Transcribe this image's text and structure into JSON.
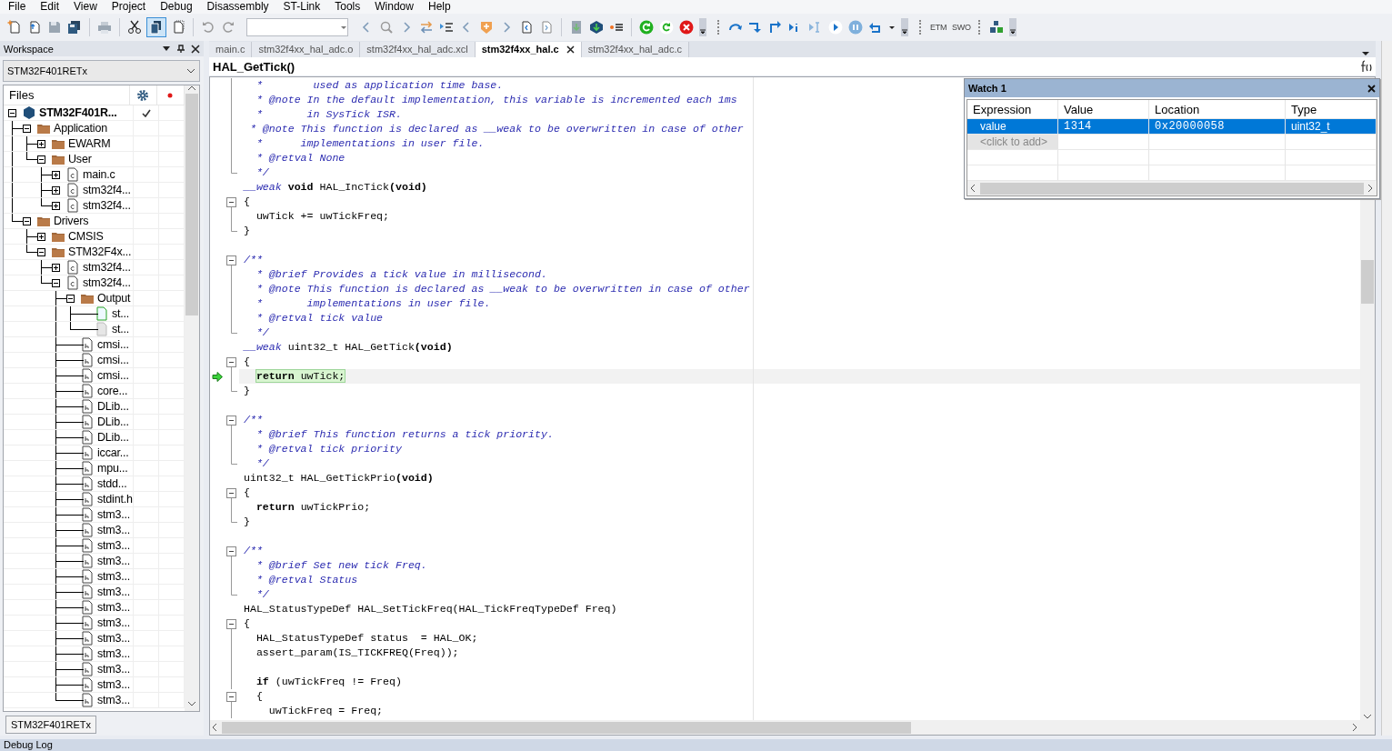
{
  "menu": [
    "File",
    "Edit",
    "View",
    "Project",
    "Debug",
    "Disassembly",
    "ST-Link",
    "Tools",
    "Window",
    "Help"
  ],
  "toolbar": {
    "labels": [
      "ETM",
      "SWO"
    ]
  },
  "workspace": {
    "title": "Workspace",
    "configuration": "STM32F401RETx",
    "files_header": "Files",
    "bottom_tab": "STM32F401RETx",
    "tree": [
      {
        "label": "STM32F401R...",
        "kind": "project",
        "expanded": true,
        "checked": true,
        "children": [
          {
            "label": "Application",
            "kind": "folder",
            "expanded": true,
            "checked": false,
            "children": [
              {
                "label": "EWARM",
                "kind": "folder",
                "expanded": false,
                "checked": false
              },
              {
                "label": "User",
                "kind": "folder",
                "expanded": true,
                "checked": false,
                "children": [
                  {
                    "label": "main.c",
                    "kind": "c_file",
                    "expanded": false,
                    "checked": false
                  },
                  {
                    "label": "stm32f4...",
                    "kind": "c_file",
                    "expanded": false,
                    "checked": false
                  },
                  {
                    "label": "stm32f4...",
                    "kind": "c_file",
                    "expanded": false,
                    "checked": false
                  }
                ]
              }
            ]
          },
          {
            "label": "Drivers",
            "kind": "folder",
            "expanded": true,
            "checked": false,
            "children": [
              {
                "label": "CMSIS",
                "kind": "folder",
                "expanded": false,
                "checked": false
              },
              {
                "label": "STM32F4x...",
                "kind": "folder",
                "expanded": true,
                "checked": false,
                "children": [
                  {
                    "label": "stm32f4...",
                    "kind": "c_file",
                    "expanded": false,
                    "checked": false
                  },
                  {
                    "label": "stm32f4...",
                    "kind": "c_file",
                    "expanded": true,
                    "checked": false,
                    "children": [
                      {
                        "label": "Output",
                        "kind": "folder",
                        "expanded": true,
                        "checked": false,
                        "children": [
                          {
                            "label": "st...",
                            "kind": "new_file",
                            "checked": false
                          },
                          {
                            "label": "st...",
                            "kind": "file",
                            "checked": false
                          }
                        ]
                      },
                      {
                        "label": "cmsi...",
                        "kind": "h_file",
                        "checked": false
                      },
                      {
                        "label": "cmsi...",
                        "kind": "h_file",
                        "checked": false
                      },
                      {
                        "label": "cmsi...",
                        "kind": "h_file",
                        "checked": false
                      },
                      {
                        "label": "core...",
                        "kind": "h_file",
                        "checked": false
                      },
                      {
                        "label": "DLib...",
                        "kind": "h_file",
                        "checked": false
                      },
                      {
                        "label": "DLib...",
                        "kind": "h_file",
                        "checked": false
                      },
                      {
                        "label": "DLib...",
                        "kind": "h_file",
                        "checked": false
                      },
                      {
                        "label": "iccar...",
                        "kind": "h_file",
                        "checked": false
                      },
                      {
                        "label": "mpu...",
                        "kind": "h_file",
                        "checked": false
                      },
                      {
                        "label": "stdd...",
                        "kind": "h_file",
                        "checked": false
                      },
                      {
                        "label": "stdint.h",
                        "kind": "h_file",
                        "checked": false
                      },
                      {
                        "label": "stm3...",
                        "kind": "h_file",
                        "checked": false
                      },
                      {
                        "label": "stm3...",
                        "kind": "h_file",
                        "checked": false
                      },
                      {
                        "label": "stm3...",
                        "kind": "h_file",
                        "checked": false
                      },
                      {
                        "label": "stm3...",
                        "kind": "h_file",
                        "checked": false
                      },
                      {
                        "label": "stm3...",
                        "kind": "h_file",
                        "checked": false
                      },
                      {
                        "label": "stm3...",
                        "kind": "h_file",
                        "checked": false
                      },
                      {
                        "label": "stm3...",
                        "kind": "h_file",
                        "checked": false
                      },
                      {
                        "label": "stm3...",
                        "kind": "h_file",
                        "checked": false
                      },
                      {
                        "label": "stm3...",
                        "kind": "h_file",
                        "checked": false
                      },
                      {
                        "label": "stm3...",
                        "kind": "h_file",
                        "checked": false
                      },
                      {
                        "label": "stm3...",
                        "kind": "h_file",
                        "checked": false
                      },
                      {
                        "label": "stm3...",
                        "kind": "h_file",
                        "checked": false
                      },
                      {
                        "label": "stm3...",
                        "kind": "h_file",
                        "checked": false
                      }
                    ]
                  }
                ]
              }
            ]
          }
        ]
      }
    ]
  },
  "editor": {
    "tabs": [
      {
        "label": "main.c",
        "selected": false
      },
      {
        "label": "stm32f4xx_hal_adc.o",
        "selected": false
      },
      {
        "label": "stm32f4xx_hal_adc.xcl",
        "selected": false
      },
      {
        "label": "stm32f4xx_hal.c",
        "selected": true
      },
      {
        "label": "stm32f4xx_hal_adc.c",
        "selected": false
      }
    ],
    "function_bar": "HAL_GetTick()",
    "lines": [
      {
        "kind": "fold_body",
        "current": false,
        "segments": [
          {
            "text": "  *        used as application time base.",
            "kind": "comment"
          }
        ]
      },
      {
        "kind": "fold_body",
        "current": false,
        "segments": [
          {
            "text": "  * @note In the default implementation, this variable is incremented each 1ms",
            "kind": "comment"
          }
        ]
      },
      {
        "kind": "fold_body",
        "current": false,
        "segments": [
          {
            "text": "  *       in SysTick ISR.",
            "kind": "comment"
          }
        ]
      },
      {
        "kind": "fold_body",
        "current": false,
        "segments": [
          {
            "text": " * @note This function is declared as __weak to be overwritten in case of other",
            "kind": "comment"
          }
        ]
      },
      {
        "kind": "fold_body",
        "current": false,
        "segments": [
          {
            "text": "  *      implementations in user file.",
            "kind": "comment"
          }
        ]
      },
      {
        "kind": "fold_body",
        "current": false,
        "segments": [
          {
            "text": "  * @retval None",
            "kind": "comment"
          }
        ]
      },
      {
        "kind": "fold_end",
        "current": false,
        "segments": [
          {
            "text": "  */",
            "kind": "comment"
          }
        ]
      },
      {
        "kind": "plain",
        "current": false,
        "segments": [
          {
            "text": "__weak",
            "kind": "modifier"
          },
          {
            "text": " void",
            "kind": "keyword"
          },
          {
            "text": " HAL_IncTick",
            "kind": "plain"
          },
          {
            "text": "(void)",
            "kind": "keyword"
          }
        ]
      },
      {
        "kind": "fold_start",
        "current": false,
        "segments": [
          {
            "text": "{",
            "kind": "plain"
          }
        ]
      },
      {
        "kind": "fold_body",
        "current": false,
        "segments": [
          {
            "text": "  uwTick += uwTickFreq;",
            "kind": "plain"
          }
        ]
      },
      {
        "kind": "fold_end",
        "current": false,
        "segments": [
          {
            "text": "}",
            "kind": "plain"
          }
        ]
      },
      {
        "kind": "plain",
        "current": false
      },
      {
        "kind": "fold_start",
        "current": false,
        "segments": [
          {
            "text": "/**",
            "kind": "comment"
          }
        ]
      },
      {
        "kind": "fold_body",
        "current": false,
        "segments": [
          {
            "text": "  * @brief Provides a tick value in millisecond.",
            "kind": "comment"
          }
        ]
      },
      {
        "kind": "fold_body",
        "current": false,
        "segments": [
          {
            "text": "  * @note This function is declared as __weak to be overwritten in case of other",
            "kind": "comment"
          }
        ]
      },
      {
        "kind": "fold_body",
        "current": false,
        "segments": [
          {
            "text": "  *       implementations in user file.",
            "kind": "comment"
          }
        ]
      },
      {
        "kind": "fold_body",
        "current": false,
        "segments": [
          {
            "text": "  * @retval tick value",
            "kind": "comment"
          }
        ]
      },
      {
        "kind": "fold_end",
        "current": false,
        "segments": [
          {
            "text": "  */",
            "kind": "comment"
          }
        ]
      },
      {
        "kind": "plain",
        "current": false,
        "segments": [
          {
            "text": "__weak",
            "kind": "modifier"
          },
          {
            "text": " uint32_t HAL_GetTick",
            "kind": "plain"
          },
          {
            "text": "(void)",
            "kind": "keyword"
          }
        ]
      },
      {
        "kind": "fold_start",
        "current": false,
        "segments": [
          {
            "text": "{",
            "kind": "plain"
          }
        ]
      },
      {
        "kind": "fold_body",
        "current": true,
        "segments": [
          {
            "text": "  return",
            "kind": "keyword"
          },
          {
            "text": " uwTick;",
            "kind": "plain"
          }
        ]
      },
      {
        "kind": "fold_end",
        "current": false,
        "segments": [
          {
            "text": "}",
            "kind": "plain"
          }
        ]
      },
      {
        "kind": "plain",
        "current": false
      },
      {
        "kind": "fold_start",
        "current": false,
        "segments": [
          {
            "text": "/**",
            "kind": "comment"
          }
        ]
      },
      {
        "kind": "fold_body",
        "current": false,
        "segments": [
          {
            "text": "  * @brief This function returns a tick priority.",
            "kind": "comment"
          }
        ]
      },
      {
        "kind": "fold_body",
        "current": false,
        "segments": [
          {
            "text": "  * @retval tick priority",
            "kind": "comment"
          }
        ]
      },
      {
        "kind": "fold_end",
        "current": false,
        "segments": [
          {
            "text": "  */",
            "kind": "comment"
          }
        ]
      },
      {
        "kind": "plain",
        "current": false,
        "segments": [
          {
            "text": "uint32_t HAL_GetTickPrio",
            "kind": "plain"
          },
          {
            "text": "(void)",
            "kind": "keyword"
          }
        ]
      },
      {
        "kind": "fold_start",
        "current": false,
        "segments": [
          {
            "text": "{",
            "kind": "plain"
          }
        ]
      },
      {
        "kind": "fold_body",
        "current": false,
        "segments": [
          {
            "text": "  return",
            "kind": "keyword"
          },
          {
            "text": " uwTickPrio;",
            "kind": "plain"
          }
        ]
      },
      {
        "kind": "fold_end",
        "current": false,
        "segments": [
          {
            "text": "}",
            "kind": "plain"
          }
        ]
      },
      {
        "kind": "plain",
        "current": false
      },
      {
        "kind": "fold_start",
        "current": false,
        "segments": [
          {
            "text": "/**",
            "kind": "comment"
          }
        ]
      },
      {
        "kind": "fold_body",
        "current": false,
        "segments": [
          {
            "text": "  * @brief Set new tick Freq.",
            "kind": "comment"
          }
        ]
      },
      {
        "kind": "fold_body",
        "current": false,
        "segments": [
          {
            "text": "  * @retval Status",
            "kind": "comment"
          }
        ]
      },
      {
        "kind": "fold_end",
        "current": false,
        "segments": [
          {
            "text": "  */",
            "kind": "comment"
          }
        ]
      },
      {
        "kind": "plain",
        "current": false,
        "segments": [
          {
            "text": "HAL_StatusTypeDef HAL_SetTickFreq(HAL_TickFreqTypeDef Freq)",
            "kind": "plain"
          }
        ]
      },
      {
        "kind": "fold_start",
        "current": false,
        "segments": [
          {
            "text": "{",
            "kind": "plain"
          }
        ]
      },
      {
        "kind": "fold_body",
        "current": false,
        "segments": [
          {
            "text": "  HAL_StatusTypeDef status  = HAL_OK;",
            "kind": "plain"
          }
        ]
      },
      {
        "kind": "fold_body",
        "current": false,
        "segments": [
          {
            "text": "  assert_param(IS_TICKFREQ(Freq));",
            "kind": "plain"
          }
        ]
      },
      {
        "kind": "fold_body",
        "current": false
      },
      {
        "kind": "fold_body",
        "current": false,
        "segments": [
          {
            "text": "  if",
            "kind": "keyword"
          },
          {
            "text": " (uwTickFreq != Freq)",
            "kind": "plain"
          }
        ]
      },
      {
        "kind": "fold_start",
        "current": false,
        "segments": [
          {
            "text": "  {",
            "kind": "plain"
          }
        ]
      },
      {
        "kind": "fold_body",
        "current": false,
        "segments": [
          {
            "text": "    uwTickFreq = Freq;",
            "kind": "plain"
          }
        ]
      }
    ]
  },
  "watch": {
    "title": "Watch 1",
    "columns": [
      "Expression",
      "Value",
      "Location",
      "Type"
    ],
    "rows": [
      {
        "expression": "value",
        "value": "1314",
        "location": "0x20000058",
        "type": "uint32_t",
        "selected": true
      }
    ],
    "add_row": "<click to add>"
  },
  "status_bar": {
    "panel_tab": "Debug Log"
  }
}
